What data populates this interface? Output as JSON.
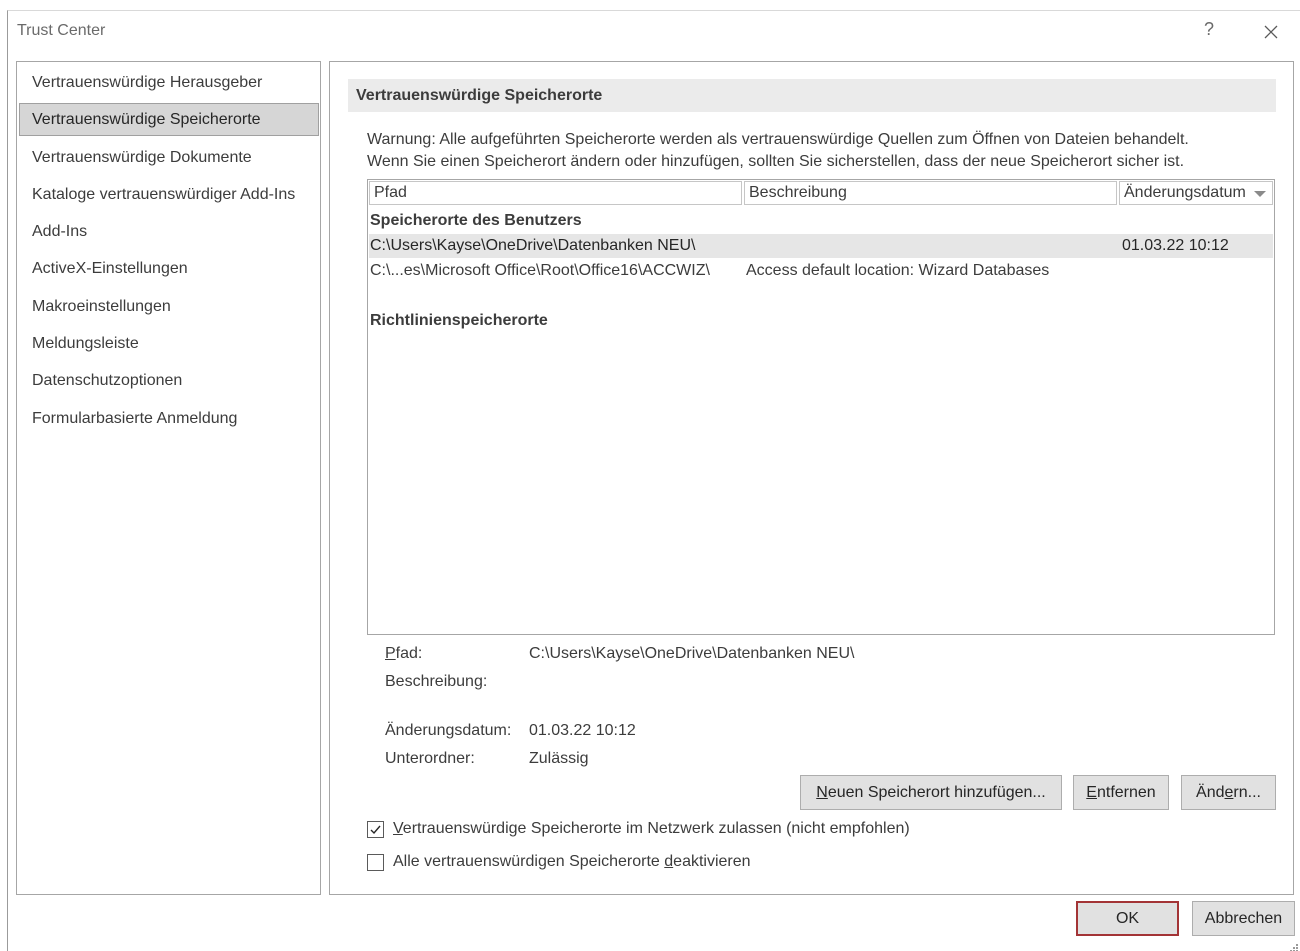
{
  "window": {
    "title": "Trust Center",
    "help": "?"
  },
  "sidebar": {
    "items": [
      {
        "label": "Vertrauenswürdige Herausgeber"
      },
      {
        "label": "Vertrauenswürdige Speicherorte",
        "selected": true
      },
      {
        "label": "Vertrauenswürdige Dokumente"
      },
      {
        "label": "Kataloge vertrauenswürdiger Add-Ins"
      },
      {
        "label": "Add-Ins"
      },
      {
        "label": "ActiveX-Einstellungen"
      },
      {
        "label": "Makroeinstellungen"
      },
      {
        "label": "Meldungsleiste"
      },
      {
        "label": "Datenschutzoptionen"
      },
      {
        "label": "Formularbasierte Anmeldung"
      }
    ]
  },
  "main": {
    "header": "Vertrauenswürdige Speicherorte",
    "warning_line1": "Warnung: Alle aufgeführten Speicherorte werden als vertrauenswürdige Quellen zum Öffnen von Dateien behandelt.",
    "warning_line2": "Wenn Sie einen Speicherort ändern oder hinzufügen, sollten Sie sicherstellen, dass der neue Speicherort sicher ist.",
    "table": {
      "columns": [
        "Pfad",
        "Beschreibung",
        "Änderungsdatum"
      ],
      "groups": [
        {
          "label": "Speicherorte des Benutzers",
          "rows": [
            {
              "path": "C:\\Users\\Kayse\\OneDrive\\Datenbanken NEU\\",
              "description": "",
              "date": "01.03.22 10:12",
              "selected": true
            },
            {
              "path": "C:\\...es\\Microsoft Office\\Root\\Office16\\ACCWIZ\\",
              "description": "Access default location: Wizard Databases",
              "date": ""
            }
          ]
        },
        {
          "label": "Richtlinienspeicherorte",
          "rows": []
        }
      ]
    },
    "details": {
      "path_label": "Pfad:",
      "path_value": "C:\\Users\\Kayse\\OneDrive\\Datenbanken NEU\\",
      "description_label": "Beschreibung:",
      "description_value": "",
      "date_label": "Änderungsdatum:",
      "date_value": "01.03.22 10:12",
      "subfolders_label": "Unterordner:",
      "subfolders_value": "Zulässig"
    },
    "buttons": {
      "add": "Neuen Speicherort hinzufügen...",
      "remove": "Entfernen",
      "modify": "Ändern..."
    },
    "checkboxes": [
      {
        "label": "Vertrauenswürdige Speicherorte im Netzwerk zulassen (nicht empfohlen)",
        "checked": true
      },
      {
        "label": "Alle vertrauenswürdigen Speicherorte deaktivieren",
        "checked": false
      }
    ]
  },
  "footer": {
    "ok": "OK",
    "cancel": "Abbrechen"
  },
  "colors": {
    "ok_border": "#a33436",
    "selection": "#e6e6e6",
    "header_bg": "#ebebeb"
  },
  "icons": {
    "help": "question-mark-icon",
    "close": "close-icon",
    "sort": "sort-down-icon",
    "check": "checkmark-icon",
    "grip": "resize-grip-icon"
  }
}
